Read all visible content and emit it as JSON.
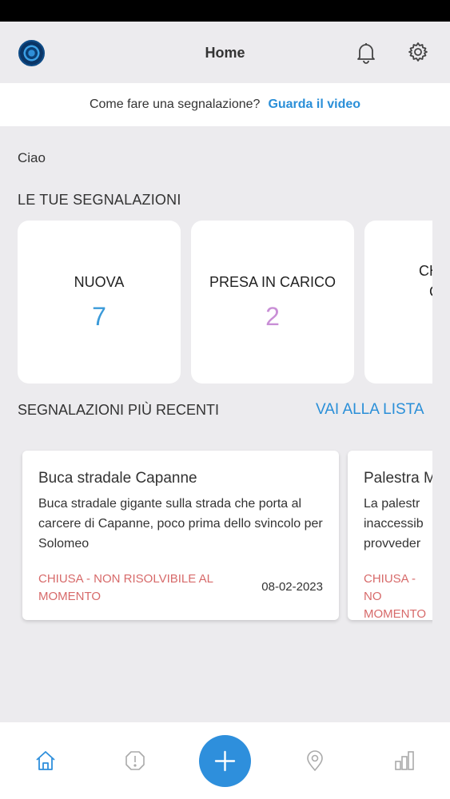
{
  "header": {
    "title": "Home"
  },
  "video_bar": {
    "question": "Come fare una segnalazione?",
    "link": "Guarda il video"
  },
  "greeting": "Ciao",
  "my_reports": {
    "title": "LE TUE SEGNALAZIONI",
    "cards": [
      {
        "label": "NUOVA",
        "count": "7",
        "color": "#3a9ad9"
      },
      {
        "label": "PRESA IN CARICO",
        "count": "2",
        "color": "#c98fd6"
      },
      {
        "label": "CHIUSA\nCOM",
        "count": "",
        "color": "#333333"
      }
    ]
  },
  "recent": {
    "title": "SEGNALAZIONI PIÙ RECENTI",
    "link": "VAI ALLA LISTA",
    "items": [
      {
        "title": "Buca stradale Capanne",
        "description": " Buca stradale gigante sulla strada che porta al carcere di Capanne, poco prima dello svincolo per Solomeo",
        "status": "CHIUSA - NON RISOLVIBILE AL MOMENTO",
        "date": "08-02-2023"
      },
      {
        "title": "Palestra M",
        "description": " La palestr inaccessib provveder",
        "status": "CHIUSA - NO MOMENTO",
        "date": ""
      }
    ]
  },
  "colors": {
    "accent": "#2a8fd8",
    "closed_status": "#d76a6a",
    "background": "#ecebee"
  },
  "bottom_nav": {
    "items": [
      "home-icon",
      "alert-icon",
      "add-button",
      "location-icon",
      "stats-icon"
    ]
  }
}
